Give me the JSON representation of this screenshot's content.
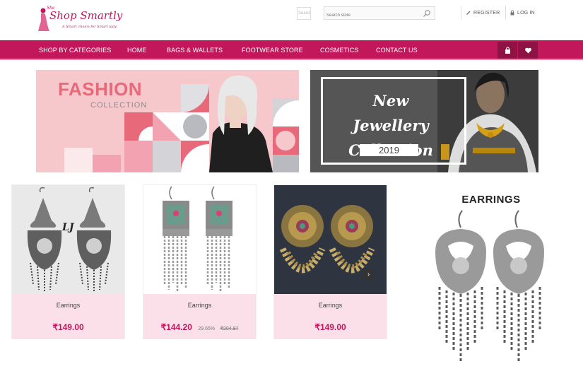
{
  "header": {
    "logo": {
      "she": "She",
      "name": "Shop Smartly",
      "tagline": "A Smart choice for Smart lady"
    },
    "mini_search_placeholder": "Search",
    "search": {
      "placeholder": "Search store"
    },
    "register_label": "REGISTER",
    "login_label": "LOG IN"
  },
  "nav": {
    "items": [
      "SHOP BY CATEGORIES",
      "HOME",
      "BAGS & WALLETS",
      "FOOTWEAR STORE",
      "COSMETICS",
      "CONTACT US"
    ],
    "cart_icon": "shopping-bag-icon",
    "wishlist_icon": "heart-icon"
  },
  "banners": {
    "fashion": {
      "title": "FASHION",
      "subtitle": "COLLECTION"
    },
    "jewellery": {
      "title_line1": "New Jewellery",
      "title_line2": "Collection",
      "year": "2019"
    }
  },
  "products": [
    {
      "name": "Earrings",
      "price": "₹149.00",
      "discount": "",
      "old_price": "",
      "image_label": "LJ"
    },
    {
      "name": "Earrings",
      "price": "₹144.20",
      "discount": "29.65%",
      "old_price": "₹204.97"
    },
    {
      "name": "Earrings",
      "price": "₹149.00",
      "discount": "",
      "old_price": ""
    }
  ],
  "promo": {
    "title": "EARRINGS"
  },
  "colors": {
    "brand": "#c2185b",
    "brand_dark": "#8e1344",
    "card_footer": "#fbe0ea"
  }
}
